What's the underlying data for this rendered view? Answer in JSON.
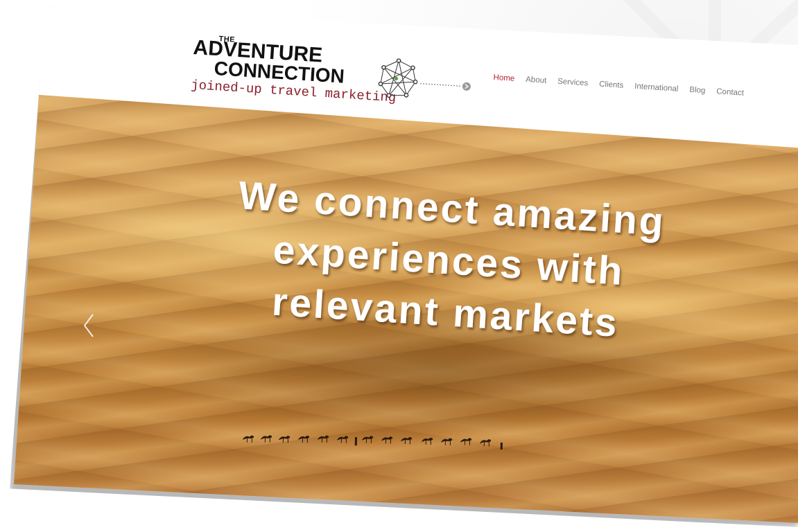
{
  "logo": {
    "the": "THE",
    "line1": "ADVENTURE",
    "line2": "CONNECTION",
    "tagline": "joined-up travel marketing"
  },
  "nav": {
    "items": [
      {
        "label": "Home",
        "active": true
      },
      {
        "label": "About",
        "active": false
      },
      {
        "label": "Services",
        "active": false
      },
      {
        "label": "Clients",
        "active": false
      },
      {
        "label": "International",
        "active": false
      },
      {
        "label": "Blog",
        "active": false
      },
      {
        "label": "Contact",
        "active": false
      }
    ]
  },
  "hero": {
    "headline_lines": [
      "We connect amazing",
      "experiences with",
      "relevant markets"
    ],
    "prev_icon": "chevron-left-icon"
  },
  "colors": {
    "nav_active": "#b8202b",
    "nav_default": "#777777",
    "tagline": "#8b1f2b",
    "headline": "#ffffff"
  }
}
